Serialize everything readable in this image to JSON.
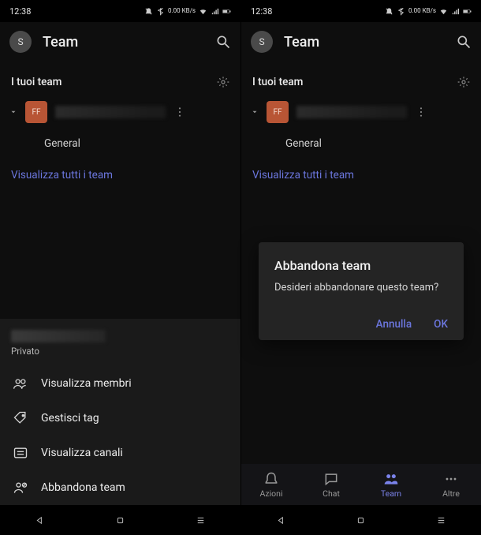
{
  "status": {
    "time": "12:38",
    "net_label": "0.00 KB/s"
  },
  "header": {
    "title": "Team",
    "avatar_letter": "S"
  },
  "section": {
    "your_teams": "I tuoi team"
  },
  "team": {
    "badge_initials": "FF",
    "channel": "General"
  },
  "link": {
    "see_all": "Visualizza tutti i team"
  },
  "sheet": {
    "subtitle": "Privato",
    "items": [
      {
        "label": "Visualizza membri"
      },
      {
        "label": "Gestisci tag"
      },
      {
        "label": "Visualizza canali"
      },
      {
        "label": "Abbandona team"
      }
    ]
  },
  "nav": {
    "items": [
      {
        "label": "Azioni"
      },
      {
        "label": "Chat"
      },
      {
        "label": "Team"
      },
      {
        "label": "Altre"
      }
    ]
  },
  "dialog": {
    "title": "Abbandona team",
    "message": "Desideri abbandonare questo team?",
    "cancel": "Annulla",
    "ok": "OK"
  }
}
